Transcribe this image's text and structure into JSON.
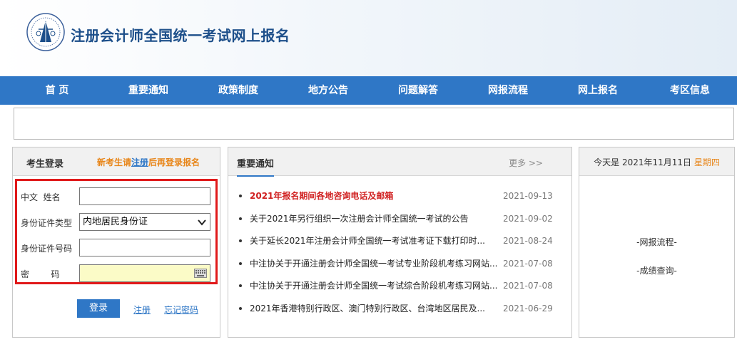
{
  "header": {
    "site_title": "注册会计师全国统一考试网上报名"
  },
  "nav": {
    "items": [
      "首  页",
      "重要通知",
      "政策制度",
      "地方公告",
      "问题解答",
      "网报流程",
      "网上报名",
      "考区信息"
    ]
  },
  "login": {
    "title": "考生登录",
    "hint_prefix": "新考生请",
    "hint_link": "注册",
    "hint_suffix": "后再登录报名",
    "name_label": "中文  姓名",
    "name_value": "",
    "id_type_label": "身份证件类型",
    "id_type_value": "内地居民身份证",
    "id_number_label": "身份证件号码",
    "id_number_value": "",
    "password_label": "密        码",
    "password_value": "",
    "login_button": "登录",
    "register_link": "注册",
    "forgot_link": "忘记密码"
  },
  "notice": {
    "title": "重要通知",
    "more": "更多 >>",
    "items": [
      {
        "title": "2021年报名期间各地咨询电话及邮箱",
        "date": "2021-09-13",
        "hot": true
      },
      {
        "title": "关于2021年另行组织一次注册会计师全国统一考试的公告",
        "date": "2021-09-02",
        "hot": false
      },
      {
        "title": "关于延长2021年注册会计师全国统一考试准考证下载打印时...",
        "date": "2021-08-24",
        "hot": false
      },
      {
        "title": "中注协关于开通注册会计师全国统一考试专业阶段机考练习网站...",
        "date": "2021-07-08",
        "hot": false
      },
      {
        "title": "中注协关于开通注册会计师全国统一考试综合阶段机考练习网站...",
        "date": "2021-07-08",
        "hot": false
      },
      {
        "title": "2021年香港特别行政区、澳门特别行政区、台湾地区居民及...",
        "date": "2021-06-29",
        "hot": false
      }
    ]
  },
  "info": {
    "date_prefix": "今天是 2021年11月11日 ",
    "weekday": "星期四",
    "links": [
      "-网报流程-",
      "-成绩查询-"
    ]
  },
  "colors": {
    "nav_bg": "#2f77c6",
    "title_blue": "#1d4f8a",
    "hint_orange": "#e8861a",
    "highlight_red": "#e0191a"
  }
}
